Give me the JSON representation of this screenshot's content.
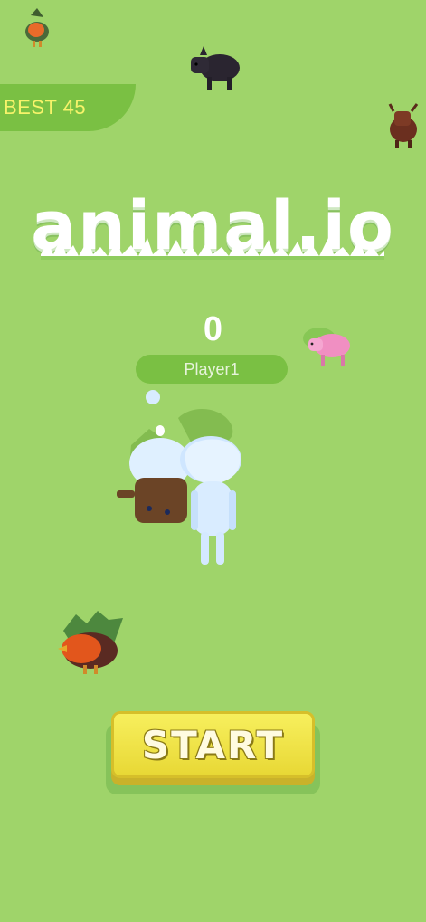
{
  "hud": {
    "best_label": "BEST 45"
  },
  "logo": {
    "text": "animal.io"
  },
  "player": {
    "score": "0",
    "name": "Player1"
  },
  "start_button": {
    "label": "START"
  },
  "colors": {
    "background": "#9fd46a",
    "badge": "#7ac043",
    "best_text": "#f7f36a",
    "button": "#f2e84a"
  }
}
